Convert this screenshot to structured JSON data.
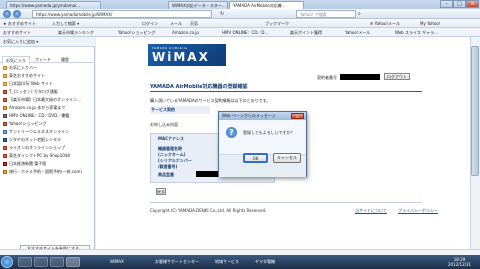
{
  "browser": {
    "tabs": [
      {
        "label": "https://www.yamada.jp/ymdamar..."
      },
      {
        "label": "WiMAX対応データ・スター..."
      },
      {
        "label": "YAMADA AirMobile対応機..."
      }
    ],
    "url": "https://www.yamadamobile.jp/WiMAX/",
    "search_placeholder": "Yahoo! で検索",
    "toolbar": {
      "add_site": "おすすめサイト",
      "yahoo_search": "入力して検索",
      "rakuten": "楽天市場",
      "login": "ログイン",
      "items": [
        "メール",
        "天気",
        "ツール",
        "お気に入り",
        "ブックマーク"
      ],
      "yahoo_mail": "Yahoo!メール",
      "my_yahoo": "My Yahoo!"
    },
    "bookmarks": [
      "おすすめサイト",
      "楽天市場ランキング",
      "Yahoo!ショッピング",
      "Amazon.co.jp",
      "HMV ONLINE：CD／D...",
      "楽天ポイント獲得",
      "Yahoo!メール",
      "Web スライス ギャラ..."
    ]
  },
  "sidebar": {
    "add_button": "お気に入りに追加",
    "tabs": [
      "お気に入り",
      "フィード",
      "履歴"
    ],
    "items": [
      "お気に入りバー",
      "東芝おすすめサイト",
      "日本語(US) Web サイト",
      "T_(ニッセン) カタログ通販",
      "【楽天市場】日本最大級のオンライン...",
      "Amazon.co.jp 本から家電まで",
      "HMV ONLINE：CD／DVD／書籍",
      "Yahoo!ショッピング",
      "サントリーウエルネスオンライン",
      "ツタヤのネット宅配レンタル",
      "ライオンのオンラインショップ",
      "東芝ダイレクトPC by Shop1048",
      "日本経済新聞 電子版",
      "旅行・ホテル予約・国際予約(一休.com)"
    ],
    "footer_button": "おすすめサイトを有効にする..."
  },
  "page": {
    "logo_small": "YAMADA AirMobile",
    "logo_big": "WiMAX",
    "title": "YAMADA AirMobile対応機器の登録確認",
    "login_label": "契約者番号",
    "logout_button": "ログアウト",
    "intro": "購入頂いているYAMADAのサービス契約情報は以下のとおりです。",
    "service_label": "サービス契約",
    "register_intro": "お申し込み内容",
    "fields": [
      "MACアドレス",
      "機器管理名称\n(ニックネーム)",
      "(シリアルナンバー\n/製造番号)",
      "商品型番"
    ],
    "back_button": "戻る",
    "copyright": "Copyright (C) YAMADA-DENKI Co.,Ltd. All Rights Reserved.",
    "footer_links": [
      "当サイトについて",
      "プライバシーポリシー"
    ]
  },
  "dialog": {
    "title": "Web ページからのメッセージ",
    "close": "×",
    "message": "登録してもよろしいですか？",
    "ok": "OK",
    "cancel": "キャンセル"
  },
  "taskbar": {
    "items": [
      "WiMAX",
      "お客様サポートセンター",
      "地域サービス",
      "ヤマダ電機"
    ],
    "time": "18:29",
    "date": "2012/12/31"
  }
}
